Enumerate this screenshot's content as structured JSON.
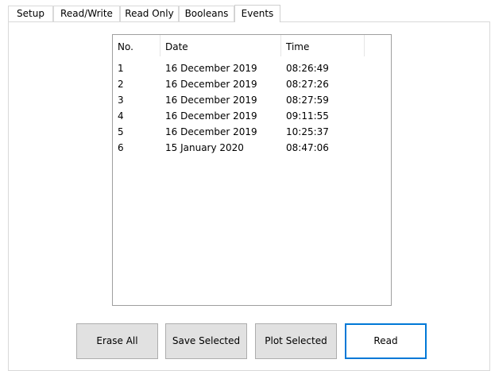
{
  "tabs": [
    {
      "label": "Setup"
    },
    {
      "label": "Read/Write"
    },
    {
      "label": "Read Only"
    },
    {
      "label": "Booleans"
    },
    {
      "label": "Events"
    }
  ],
  "events_list": {
    "columns": [
      "No.",
      "Date",
      "Time"
    ],
    "rows": [
      [
        "1",
        "16 December 2019",
        "08:26:49"
      ],
      [
        "2",
        "16 December 2019",
        "08:27:26"
      ],
      [
        "3",
        "16 December 2019",
        "08:27:59"
      ],
      [
        "4",
        "16 December 2019",
        "09:11:55"
      ],
      [
        "5",
        "16 December 2019",
        "10:25:37"
      ],
      [
        "6",
        "15 January 2020",
        "08:47:06"
      ]
    ]
  },
  "buttons": {
    "erase_all": "Erase All",
    "save_selected": "Save Selected",
    "plot_selected": "Plot Selected",
    "read": "Read"
  }
}
